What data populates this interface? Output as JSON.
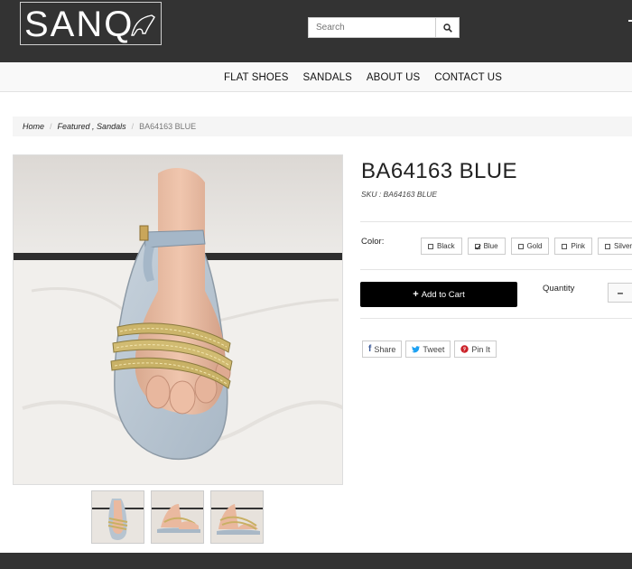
{
  "header": {
    "logo_text": "SANQ",
    "search_placeholder": "Search"
  },
  "nav": {
    "items": [
      {
        "label": "FLAT SHOES"
      },
      {
        "label": "SANDALS"
      },
      {
        "label": "ABOUT US"
      },
      {
        "label": "CONTACT US"
      }
    ]
  },
  "breadcrumb": {
    "home": "Home",
    "category": "Featured , Sandals",
    "current": "BA64163 BLUE"
  },
  "product": {
    "title": "BA64163 BLUE",
    "sku": "SKU : BA64163 BLUE",
    "color_label": "Color:",
    "colors": [
      {
        "label": "Black",
        "checked": false
      },
      {
        "label": "Blue",
        "checked": true
      },
      {
        "label": "Gold",
        "checked": false
      },
      {
        "label": "Pink",
        "checked": false
      },
      {
        "label": "Silver",
        "checked": false
      }
    ],
    "add_to_cart": "Add to Cart",
    "quantity_label": "Quantity",
    "qty_minus": "–",
    "image_alt": "Blue sandal with gold chain straps on foot mannequin",
    "thumbnail_count": 3
  },
  "share": {
    "facebook": "Share",
    "twitter": "Tweet",
    "pinterest": "Pin It"
  },
  "colors": {
    "header_bg": "#333333",
    "button_bg": "#000000",
    "facebook": "#3b5998",
    "twitter": "#1da1f2",
    "pinterest": "#cb2027"
  }
}
